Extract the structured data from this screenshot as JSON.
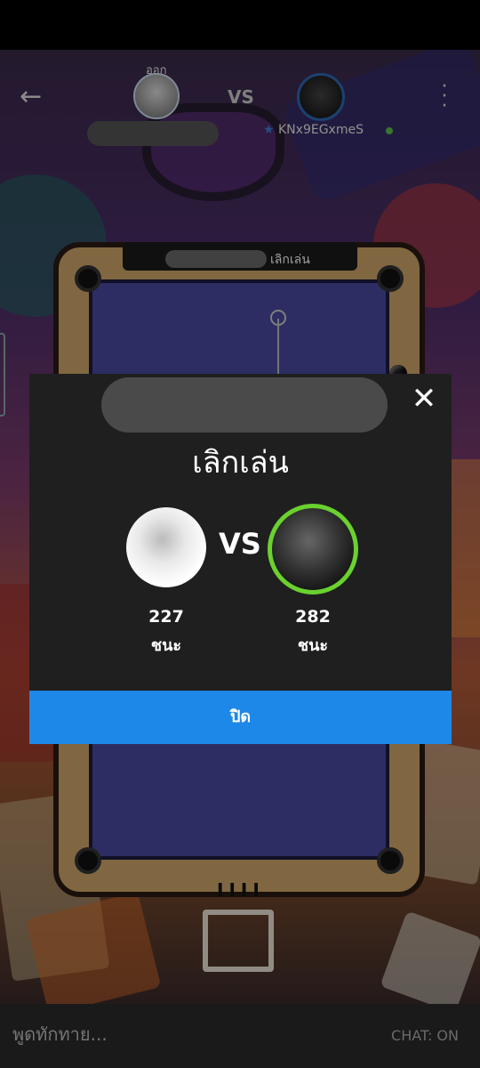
{
  "header": {
    "exit_label": "ออก",
    "vs_label": "VS",
    "player2_name": "KNx9EGxmeS"
  },
  "table": {
    "label": "เลิกเล่น",
    "rail_marks": "IIII"
  },
  "modal": {
    "title": "เลิกเล่น",
    "vs_label": "VS",
    "player1": {
      "score": "227",
      "label": "ชนะ"
    },
    "player2": {
      "score": "282",
      "label": "ชนะ"
    },
    "button_label": "ปิด",
    "close_symbol": "✕"
  },
  "chat": {
    "placeholder": "พูดทักทาย...",
    "status": "CHAT: ON"
  },
  "icons": {
    "back": "back-arrow-icon",
    "more": "more-vertical-icon",
    "close": "close-icon",
    "star": "star-icon"
  },
  "colors": {
    "accent_blue": "#1e88e8",
    "online_green": "#6ad12e",
    "modal_bg": "#1f1f1f"
  }
}
